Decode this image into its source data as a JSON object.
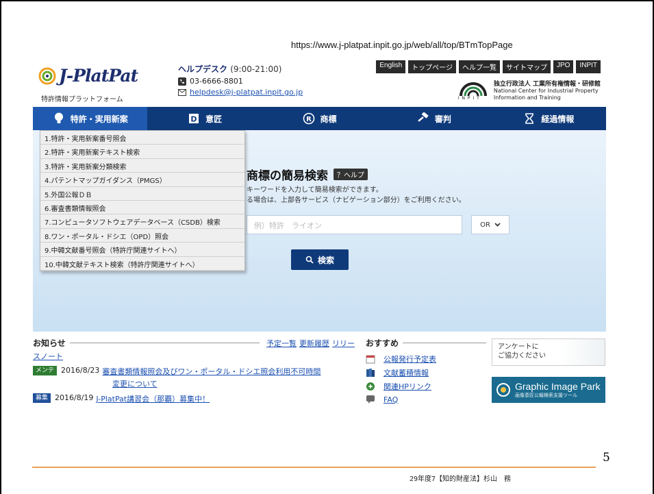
{
  "url": "https://www.j-platpat.inpit.go.jp/web/all/top/BTmTopPage",
  "header": {
    "logo_text": "J-PlatPat",
    "logo_sub": "特許情報プラットフォーム",
    "helpdesk_title": "ヘルプデスク",
    "helpdesk_hours": "(9:00-21:00)",
    "phone": "03-6666-8801",
    "email": "helpdesk@j-platpat.inpit.go.jp",
    "top_links": [
      "English",
      "トップページ",
      "ヘルプ一覧",
      "サイトマップ",
      "JPO",
      "INPIT"
    ],
    "inpit_line1": "独立行政法人 工業所有権情報・研修館",
    "inpit_line2": "National Center for Industrial Property",
    "inpit_line3": "Information and Training",
    "inpit_mark": "I N P I T"
  },
  "nav": {
    "items": [
      {
        "label": "特許・実用新案",
        "icon": "lightbulb-icon"
      },
      {
        "label": "意匠",
        "icon": "design-d-icon"
      },
      {
        "label": "商標",
        "icon": "registered-r-icon"
      },
      {
        "label": "審判",
        "icon": "gavel-icon"
      },
      {
        "label": "経過情報",
        "icon": "hourglass-icon"
      }
    ]
  },
  "dropdown": {
    "items": [
      "1.特許・実用新案番号照会",
      "2.特許・実用新案テキスト検索",
      "3.特許・実用新案分類検索",
      "4.パテントマップガイダンス（PMGS）",
      "5.外国公報ＤＢ",
      "6.審査書類情報照会",
      "7.コンピュータソフトウェアデータベース（CSDB）検索",
      "8.ワン・ポータル・ドシエ（OPD）照会",
      "9.中韓文献番号照会（特許庁関連サイトへ）",
      "10.中韓文献テキスト検索（特許庁関連サイトへ）"
    ]
  },
  "search": {
    "title": "商標の簡易検索",
    "help_label": "？ヘルプ",
    "desc1": "キーワードを入力して簡易検索ができます。",
    "desc2": "る場合は、上部各サービス（ナビゲーション部分）をご利用ください。",
    "placeholder": "例）特許　ライオン",
    "operator": "OR",
    "button": "検索"
  },
  "news": {
    "title": "お知らせ",
    "links": [
      "予定一覧",
      "更新履歴",
      "リリー"
    ],
    "snote": "スノート",
    "rows": [
      {
        "badge": "メンテ",
        "badge_color": "#2e7d32",
        "date": "2016/8/23",
        "text": "審査書類情報照会及びワン・ポータル・ドシエ照会利用不可時間",
        "text2": "変更について"
      },
      {
        "badge": "募集",
        "badge_color": "#1f4f9a",
        "date": "2016/8/19",
        "text": "J-PlatPat講習会（那覇）募集中！"
      }
    ]
  },
  "recommend": {
    "title": "おすすめ",
    "items": [
      {
        "label": "公報発行予定表",
        "icon": "calendar-icon"
      },
      {
        "label": "文献蓄積情報",
        "icon": "books-icon"
      },
      {
        "label": "関連HPリンク",
        "icon": "link-icon"
      },
      {
        "label": "FAQ",
        "icon": "faq-icon"
      }
    ],
    "survey_line1": "アンケートに",
    "survey_line2": "ご協力ください",
    "gip_title": "Graphic Image Park",
    "gip_sub": "画像意匠公報検索支援ツール"
  },
  "slide": {
    "page_number": "5",
    "footer": "29年度7【知的財産法】杉山　務"
  }
}
